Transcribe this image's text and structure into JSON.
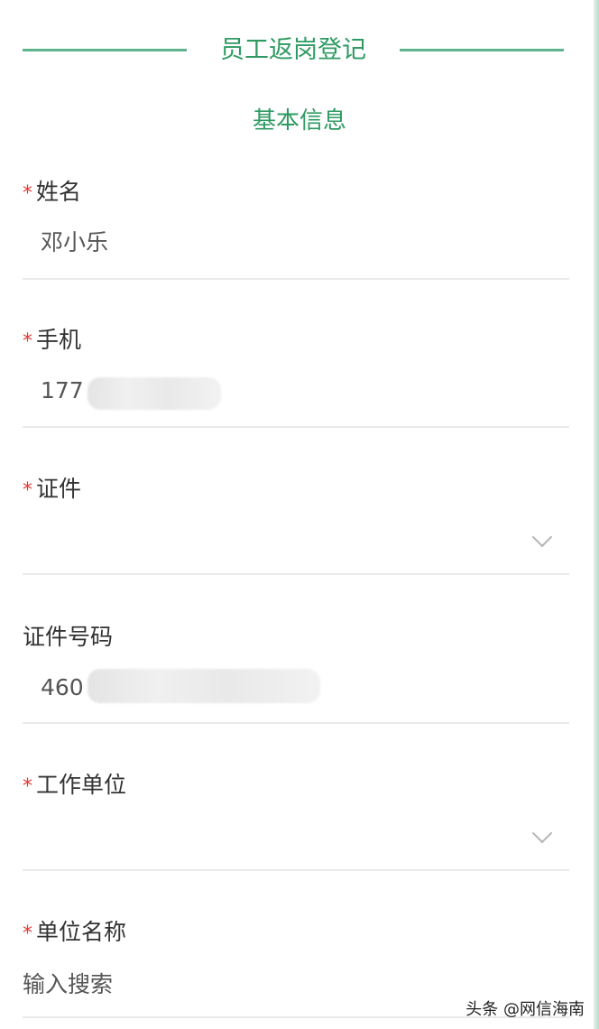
{
  "header": {
    "title": "员工返岗登记"
  },
  "section": {
    "title": "基本信息"
  },
  "fields": {
    "name": {
      "required": "*",
      "label": "姓名",
      "value": "邓小乐"
    },
    "phone": {
      "required": "*",
      "label": "手机",
      "value": "177"
    },
    "id_type": {
      "required": "*",
      "label": "证件",
      "value": ""
    },
    "id_number": {
      "label": "证件号码",
      "value": "460"
    },
    "work_unit": {
      "required": "*",
      "label": "工作单位",
      "value": ""
    },
    "unit_name": {
      "required": "*",
      "label": "单位名称",
      "placeholder": "输入搜索"
    }
  },
  "footer": {
    "watermark": "头条 @网信海南"
  },
  "colors": {
    "accent": "#2e9a62",
    "required": "#e53935"
  }
}
